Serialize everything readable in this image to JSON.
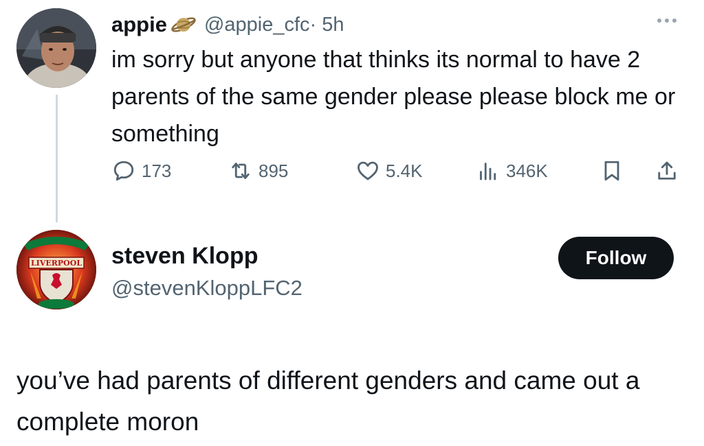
{
  "original_tweet": {
    "display_name": "appie",
    "handle": "@appie_cfc",
    "time": "· 5h",
    "text": "im sorry but anyone that thinks its normal to have 2 parents of the same gender please please block me or something",
    "stats": {
      "replies": "173",
      "retweets": "895",
      "likes": "5.4K",
      "views": "346K"
    },
    "badge_icon": "saturn-planet-icon"
  },
  "reply": {
    "display_name": "steven Klopp",
    "handle": "@stevenKloppLFC2",
    "follow_label": "Follow",
    "text": "you’ve had parents of different genders and came out a complete moron",
    "avatar_logo_text": "LIVERPOOL"
  },
  "colors": {
    "text_primary": "#0f1419",
    "text_secondary": "#536471",
    "thread_line": "#cfd9de",
    "follow_button_bg": "#0f1419"
  }
}
